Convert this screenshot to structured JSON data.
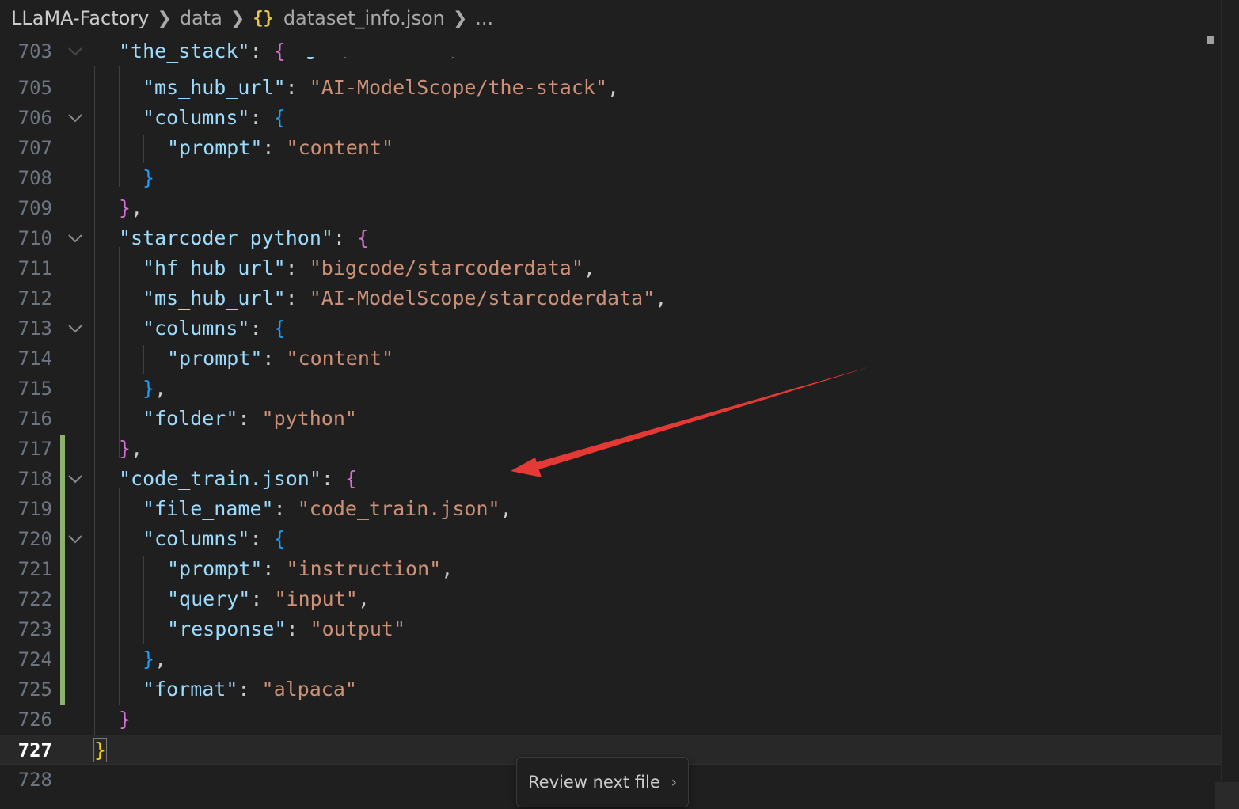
{
  "breadcrumb": {
    "root": "LLaMA-Factory",
    "folder": "data",
    "file_icon": "{}",
    "file": "dataset_info.json",
    "more": "..."
  },
  "editor": {
    "current_line": 727,
    "lines": [
      {
        "num": "703",
        "fold": true
      },
      {
        "num": "705",
        "fold": false
      },
      {
        "num": "706",
        "fold": true
      },
      {
        "num": "707",
        "fold": false
      },
      {
        "num": "708",
        "fold": false
      },
      {
        "num": "709",
        "fold": false
      },
      {
        "num": "710",
        "fold": true
      },
      {
        "num": "711",
        "fold": false
      },
      {
        "num": "712",
        "fold": false
      },
      {
        "num": "713",
        "fold": true
      },
      {
        "num": "714",
        "fold": false
      },
      {
        "num": "715",
        "fold": false
      },
      {
        "num": "716",
        "fold": false
      },
      {
        "num": "717",
        "fold": false
      },
      {
        "num": "718",
        "fold": true
      },
      {
        "num": "719",
        "fold": false
      },
      {
        "num": "720",
        "fold": true
      },
      {
        "num": "721",
        "fold": false
      },
      {
        "num": "722",
        "fold": false
      },
      {
        "num": "723",
        "fold": false
      },
      {
        "num": "724",
        "fold": false
      },
      {
        "num": "725",
        "fold": false
      },
      {
        "num": "726",
        "fold": false
      },
      {
        "num": "727",
        "fold": false
      },
      {
        "num": "728",
        "fold": false
      }
    ],
    "code": {
      "l703_key": "\"the_stack\"",
      "l705_key": "\"ms_hub_url\"",
      "l705_val": "\"AI-ModelScope/the-stack\"",
      "l706_key": "\"columns\"",
      "l707_key": "\"prompt\"",
      "l707_val": "\"content\"",
      "l710_key": "\"starcoder_python\"",
      "l711_key": "\"hf_hub_url\"",
      "l711_val": "\"bigcode/starcoderdata\"",
      "l712_key": "\"ms_hub_url\"",
      "l712_val": "\"AI-ModelScope/starcoderdata\"",
      "l713_key": "\"columns\"",
      "l714_key": "\"prompt\"",
      "l714_val": "\"content\"",
      "l716_key": "\"folder\"",
      "l716_val": "\"python\"",
      "l718_key": "\"code_train.json\"",
      "l719_key": "\"file_name\"",
      "l719_val": "\"code_train.json\"",
      "l720_key": "\"columns\"",
      "l721_key": "\"prompt\"",
      "l721_val": "\"instruction\"",
      "l722_key": "\"query\"",
      "l722_val": "\"input\"",
      "l723_key": "\"response\"",
      "l723_val": "\"output\"",
      "l725_key": "\"format\"",
      "l725_val": "\"alpaca\""
    }
  },
  "review_button": {
    "label": "Review next file",
    "chevron": "›"
  },
  "colors": {
    "background": "#1f1f1f",
    "key": "#9cdcfe",
    "string": "#ce9178",
    "bracket_level1": "#da70d6",
    "bracket_level2": "#179fff",
    "bracket_root": "#ffd700",
    "git_added": "#8db26f",
    "annotation_arrow": "#e53935"
  }
}
